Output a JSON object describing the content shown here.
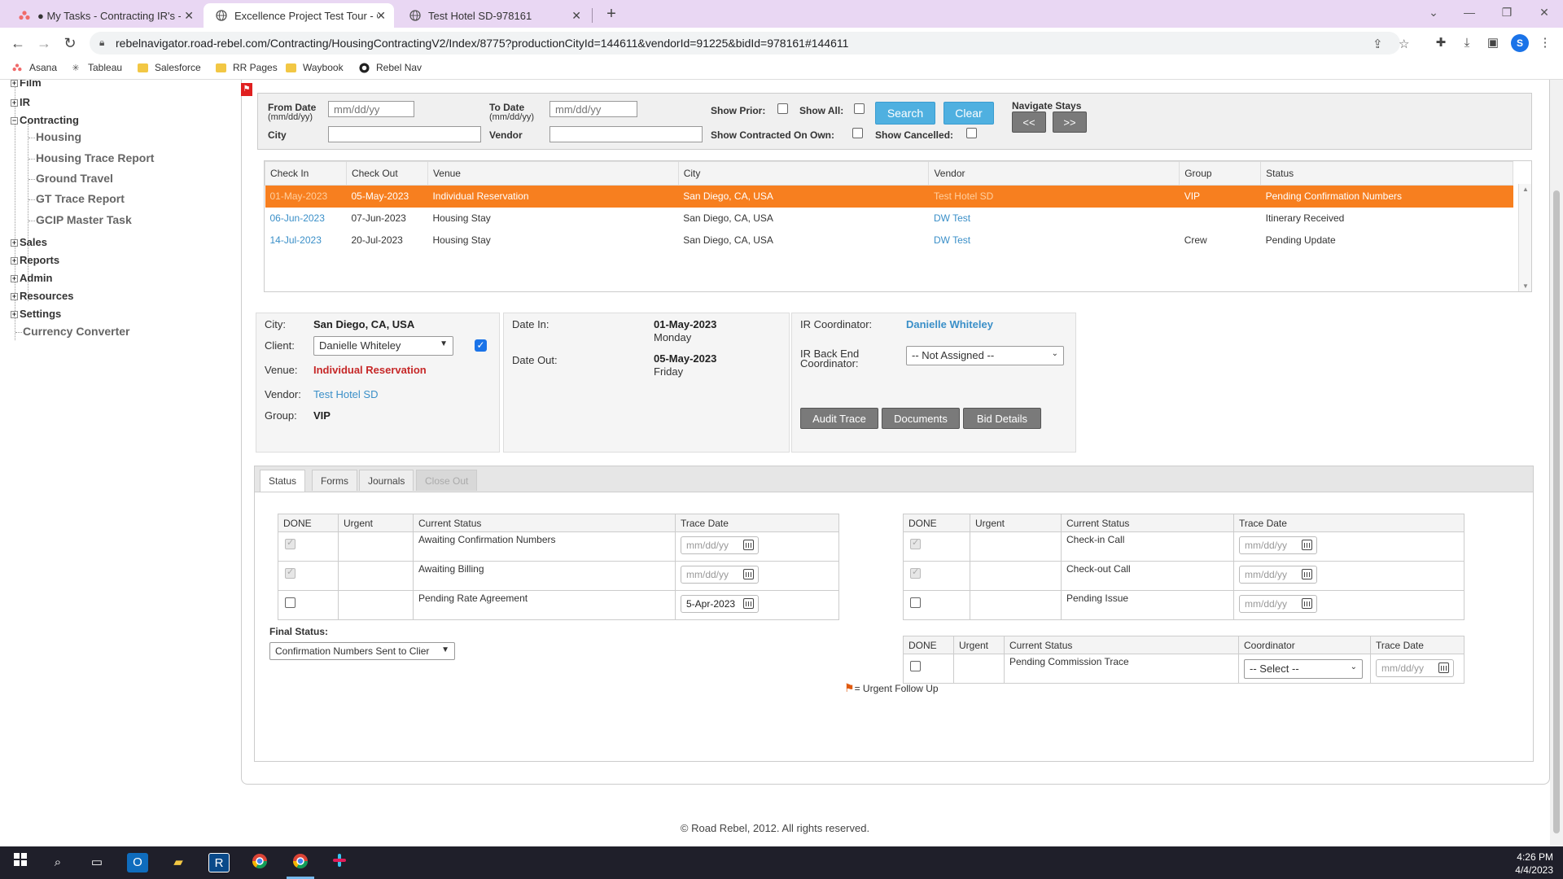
{
  "browser": {
    "tabs": [
      {
        "title": "● My Tasks - Contracting IR's - B",
        "icon": "asana-icon"
      },
      {
        "title": "Excellence Project Test Tour - Co",
        "icon": "globe-icon"
      },
      {
        "title": "Test Hotel SD-978161",
        "icon": "globe-icon"
      }
    ],
    "url": "rebelnavigator.road-rebel.com/Contracting/HousingContractingV2/Index/8775?productionCityId=144611&vendorId=91225&bidId=978161#144611",
    "profile_initial": "S",
    "bookmarks": [
      "Asana",
      "Tableau",
      "Salesforce",
      "RR Pages",
      "Waybook",
      "Rebel Nav"
    ]
  },
  "sidebar": {
    "top": [
      {
        "label": "Film",
        "pm": "+"
      },
      {
        "label": "IR",
        "pm": "+"
      },
      {
        "label": "Contracting",
        "pm": "−"
      }
    ],
    "contracting_children": [
      "Housing",
      "Housing Trace Report",
      "Ground Travel",
      "GT Trace Report",
      "GCIP Master Task"
    ],
    "bottom": [
      {
        "label": "Sales",
        "pm": "+"
      },
      {
        "label": "Reports",
        "pm": "+"
      },
      {
        "label": "Admin",
        "pm": "+"
      },
      {
        "label": "Resources",
        "pm": "+"
      },
      {
        "label": "Settings",
        "pm": "+"
      }
    ],
    "currency": "Currency Converter"
  },
  "search": {
    "from_date_label": "From Date",
    "date_hint": "(mm/dd/yy)",
    "to_date_label": "To Date",
    "date_placeholder": "mm/dd/yy",
    "city_label": "City",
    "vendor_label": "Vendor",
    "show_prior_label": "Show Prior:",
    "show_all_label": "Show All:",
    "show_contracted_label": "Show Contracted On Own:",
    "show_cancelled_label": "Show Cancelled:",
    "search_button": "Search",
    "clear_button": "Clear",
    "navigate_label": "Navigate Stays",
    "prev_button": "<<",
    "next_button": ">>"
  },
  "results": {
    "columns": [
      "Check In",
      "Check Out",
      "Venue",
      "City",
      "Vendor",
      "Group",
      "Status"
    ],
    "rows": [
      {
        "check_in": "01-May-2023",
        "check_out": "05-May-2023",
        "venue": "Individual Reservation",
        "city": "San Diego, CA, USA",
        "vendor": "Test Hotel SD",
        "group": "VIP",
        "status": "Pending Confirmation Numbers",
        "selected": true
      },
      {
        "check_in": "06-Jun-2023",
        "check_out": "07-Jun-2023",
        "venue": "Housing Stay",
        "city": "San Diego, CA, USA",
        "vendor": "DW Test",
        "group": "",
        "status": "Itinerary Received",
        "selected": false
      },
      {
        "check_in": "14-Jul-2023",
        "check_out": "20-Jul-2023",
        "venue": "Housing Stay",
        "city": "San Diego, CA, USA",
        "vendor": "DW Test",
        "group": "Crew",
        "status": "Pending Update",
        "selected": false
      }
    ]
  },
  "detail": {
    "city_label": "City:",
    "city": "San Diego, CA, USA",
    "client_label": "Client:",
    "client": "Danielle Whiteley",
    "venue_label": "Venue:",
    "venue": "Individual Reservation",
    "vendor_label": "Vendor:",
    "vendor": "Test Hotel SD",
    "group_label": "Group:",
    "group": "VIP",
    "date_in_label": "Date In:",
    "date_in": "01-May-2023",
    "date_in_day": "Monday",
    "date_out_label": "Date Out:",
    "date_out": "05-May-2023",
    "date_out_day": "Friday",
    "ir_coord_label": "IR Coordinator:",
    "ir_coord": "Danielle Whiteley",
    "backend_label_1": "IR Back End",
    "backend_label_2": "Coordinator:",
    "backend_value": "-- Not Assigned --",
    "audit_button": "Audit Trace",
    "documents_button": "Documents",
    "bid_button": "Bid Details"
  },
  "tabs": [
    "Status",
    "Forms",
    "Journals",
    "Close Out"
  ],
  "status_left": {
    "columns": [
      "DONE",
      "Urgent",
      "Current Status",
      "Trace Date"
    ],
    "rows": [
      {
        "status": "Awaiting Confirmation Numbers",
        "date": "mm/dd/yy",
        "done": "gray"
      },
      {
        "status": "Awaiting Billing",
        "date": "mm/dd/yy",
        "done": "gray"
      },
      {
        "status": "Pending Rate Agreement",
        "date": "5-Apr-2023",
        "done": "empty"
      }
    ]
  },
  "status_right": {
    "columns": [
      "DONE",
      "Urgent",
      "Current Status",
      "Trace Date"
    ],
    "rows": [
      {
        "status": "Check-in Call",
        "date": "mm/dd/yy",
        "done": "gray"
      },
      {
        "status": "Check-out Call",
        "date": "mm/dd/yy",
        "done": "gray"
      },
      {
        "status": "Pending Issue",
        "date": "mm/dd/yy",
        "done": "empty"
      }
    ]
  },
  "commission": {
    "columns": [
      "DONE",
      "Urgent",
      "Current Status",
      "Coordinator",
      "Trace Date"
    ],
    "status": "Pending Commission Trace",
    "coordinator": "-- Select --",
    "date": "mm/dd/yy"
  },
  "final_status_label": "Final Status:",
  "final_status_value": "Confirmation Numbers Sent to Clier",
  "urgent_legend": "= Urgent Follow Up",
  "footer": "© Road Rebel, 2012. All rights reserved.",
  "clock": {
    "time": "4:26 PM",
    "date": "4/4/2023"
  },
  "colors": {
    "accent_orange": "#f77f1f",
    "link_blue": "#3a8fc8",
    "venue_red": "#c62828",
    "button_blue": "#4fb0e0"
  }
}
